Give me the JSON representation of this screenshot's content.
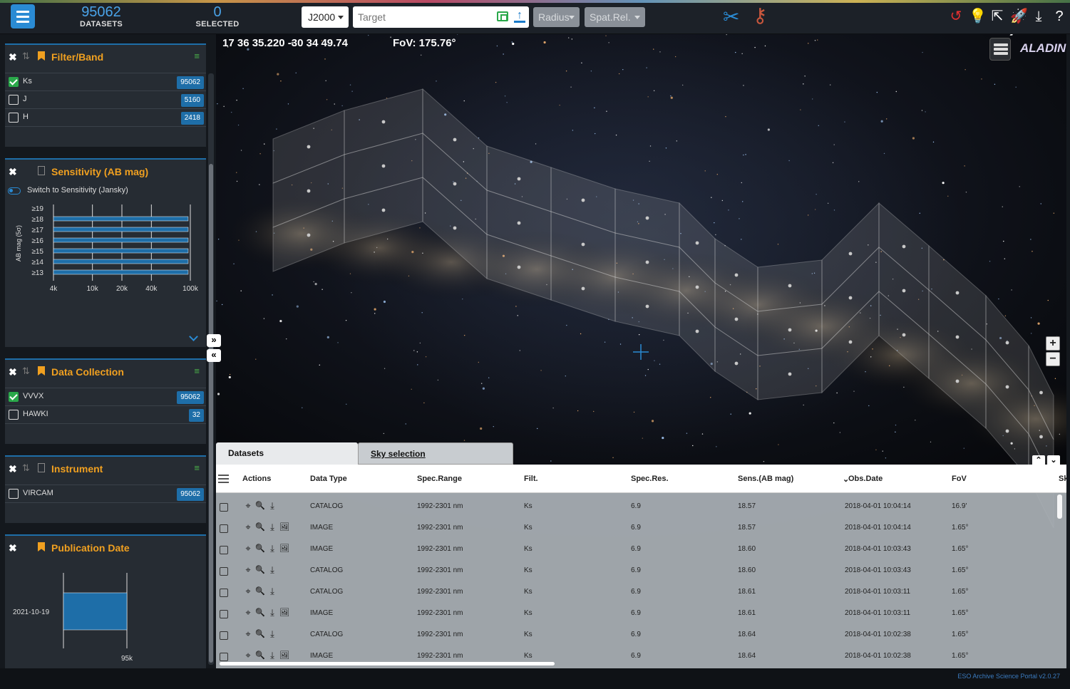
{
  "header": {
    "datasets_count": "95062",
    "datasets_label": "DATASETS",
    "selected_count": "0",
    "selected_label": "SELECTED",
    "frame": "J2000",
    "target_placeholder": "Target",
    "radius_label": "Radius",
    "spatrel_label": "Spat.Rel."
  },
  "filter_band": {
    "title": "Filter/Band",
    "items": [
      {
        "label": "Ks",
        "count": "95062",
        "checked": true
      },
      {
        "label": "J",
        "count": "5160",
        "checked": false
      },
      {
        "label": "H",
        "count": "2418",
        "checked": false
      }
    ]
  },
  "sensitivity": {
    "title": "Sensitivity (AB mag)",
    "switch_label": "Switch to Sensitivity (Jansky)",
    "chart_data": {
      "type": "bar",
      "orientation": "horizontal",
      "ylabel": "AB mag (5σ)",
      "categories": [
        "≥19",
        "≥18",
        "≥17",
        "≥16",
        "≥15",
        "≥14",
        "≥13"
      ],
      "values": [
        4000,
        95000,
        95062,
        95062,
        95062,
        95062,
        95062
      ],
      "xscale": "log",
      "xticks": [
        "4k",
        "10k",
        "20k",
        "40k",
        "100k"
      ],
      "xlim": [
        4000,
        100000
      ],
      "color": "#1e6ea8"
    }
  },
  "data_collection": {
    "title": "Data Collection",
    "items": [
      {
        "label": "VVVX",
        "count": "95062",
        "checked": true
      },
      {
        "label": "HAWKI",
        "count": "32",
        "checked": false
      }
    ]
  },
  "instrument": {
    "title": "Instrument",
    "items": [
      {
        "label": "VIRCAM",
        "count": "95062",
        "checked": false
      }
    ]
  },
  "publication_date": {
    "title": "Publication Date",
    "chart_data": {
      "type": "bar",
      "orientation": "horizontal",
      "categories": [
        "2021-10-19"
      ],
      "values": [
        95000
      ],
      "xtick": "95k",
      "color": "#1e6ea8"
    }
  },
  "sky": {
    "coords": "17 36 35.220 -30 34 49.74",
    "fov": "FoV: 175.76°",
    "logo": "ALADIN"
  },
  "tabs": [
    {
      "label": "Datasets",
      "active": true
    },
    {
      "label": "Sky selection",
      "active": false
    }
  ],
  "table": {
    "columns": [
      "Actions",
      "Data Type",
      "Spec.Range",
      "Filt.",
      "Spec.Res.",
      "Sens.(AB mag)",
      "Obs.Date",
      "FoV",
      "Sk"
    ],
    "rows": [
      {
        "type": "CATALOG",
        "range": "1992-2301 nm",
        "filt": "Ks",
        "res": "6.9",
        "sens": "18.57",
        "date": "2018-04-01 10:04:14",
        "fov": "16.9'",
        "preview": false
      },
      {
        "type": "IMAGE",
        "range": "1992-2301 nm",
        "filt": "Ks",
        "res": "6.9",
        "sens": "18.57",
        "date": "2018-04-01 10:04:14",
        "fov": "1.65°",
        "preview": true
      },
      {
        "type": "IMAGE",
        "range": "1992-2301 nm",
        "filt": "Ks",
        "res": "6.9",
        "sens": "18.60",
        "date": "2018-04-01 10:03:43",
        "fov": "1.65°",
        "preview": true
      },
      {
        "type": "CATALOG",
        "range": "1992-2301 nm",
        "filt": "Ks",
        "res": "6.9",
        "sens": "18.60",
        "date": "2018-04-01 10:03:43",
        "fov": "1.65°",
        "preview": false
      },
      {
        "type": "CATALOG",
        "range": "1992-2301 nm",
        "filt": "Ks",
        "res": "6.9",
        "sens": "18.61",
        "date": "2018-04-01 10:03:11",
        "fov": "1.65°",
        "preview": false
      },
      {
        "type": "IMAGE",
        "range": "1992-2301 nm",
        "filt": "Ks",
        "res": "6.9",
        "sens": "18.61",
        "date": "2018-04-01 10:03:11",
        "fov": "1.65°",
        "preview": true
      },
      {
        "type": "CATALOG",
        "range": "1992-2301 nm",
        "filt": "Ks",
        "res": "6.9",
        "sens": "18.64",
        "date": "2018-04-01 10:02:38",
        "fov": "1.65°",
        "preview": false
      },
      {
        "type": "IMAGE",
        "range": "1992-2301 nm",
        "filt": "Ks",
        "res": "6.9",
        "sens": "18.64",
        "date": "2018-04-01 10:02:38",
        "fov": "1.65°",
        "preview": true
      }
    ]
  },
  "footer": {
    "version": "ESO Archive Science Portal v2.0.27"
  },
  "colors": {
    "accent": "#2a8bd4",
    "panel_title": "#f0a020",
    "check": "#2aa84a",
    "badge": "#1e6ea8"
  }
}
